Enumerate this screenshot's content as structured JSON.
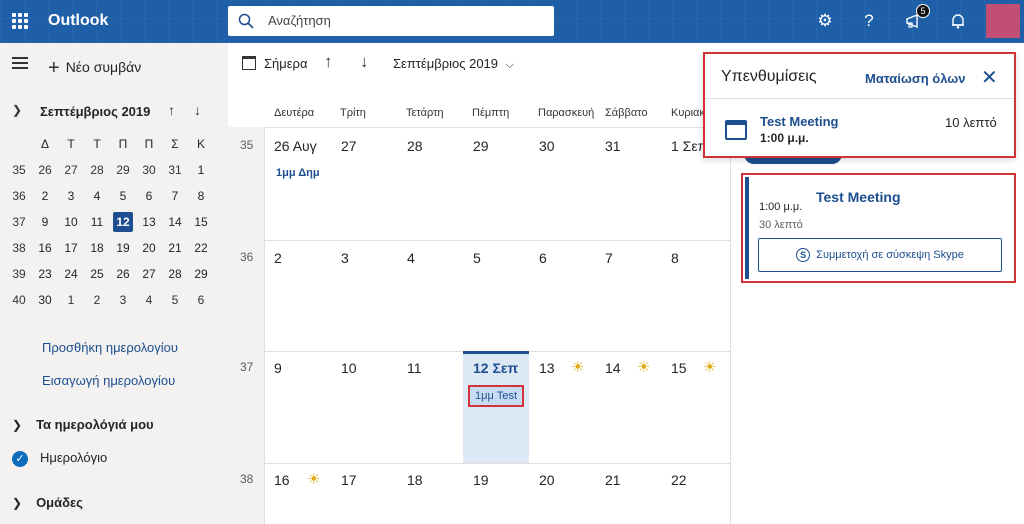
{
  "header": {
    "brand": "Outlook",
    "search_placeholder": "Αναζήτηση",
    "notification_count": "5"
  },
  "sidebar": {
    "new_event": "Νέο συμβάν",
    "mini_title": "Σεπτέμβριος 2019",
    "weekdays": [
      "Δ",
      "Τ",
      "Τ",
      "Π",
      "Π",
      "Σ",
      "Κ"
    ],
    "weeks": [
      {
        "wk": "35",
        "days": [
          "26",
          "27",
          "28",
          "29",
          "30",
          "31",
          "1"
        ]
      },
      {
        "wk": "36",
        "days": [
          "2",
          "3",
          "4",
          "5",
          "6",
          "7",
          "8"
        ]
      },
      {
        "wk": "37",
        "days": [
          "9",
          "10",
          "11",
          "12",
          "13",
          "14",
          "15"
        ]
      },
      {
        "wk": "38",
        "days": [
          "16",
          "17",
          "18",
          "19",
          "20",
          "21",
          "22"
        ]
      },
      {
        "wk": "39",
        "days": [
          "23",
          "24",
          "25",
          "26",
          "27",
          "28",
          "29"
        ]
      },
      {
        "wk": "40",
        "days": [
          "30",
          "1",
          "2",
          "3",
          "4",
          "5",
          "6"
        ]
      }
    ],
    "add_calendar": "Προσθήκη ημερολογίου",
    "import_calendar": "Εισαγωγή ημερολογίου",
    "my_calendars": "Τα ημερολόγιά μου",
    "calendar_item": "Ημερολόγιο",
    "groups": "Ομάδες"
  },
  "toolbar": {
    "today": "Σήμερα",
    "month": "Σεπτέμβριος 2019"
  },
  "calendar": {
    "day_headers": [
      "Δευτέρα",
      "Τρίτη",
      "Τετάρτη",
      "Πέμπτη",
      "Παρασκευή",
      "Σάββατο",
      "Κυριακή"
    ],
    "weeks": [
      {
        "wk": "35",
        "days": [
          "26 Αυγ",
          "27",
          "28",
          "29",
          "30",
          "31",
          "1 Σεπ"
        ]
      },
      {
        "wk": "36",
        "days": [
          "2",
          "3",
          "4",
          "5",
          "6",
          "7",
          "8"
        ]
      },
      {
        "wk": "37",
        "days": [
          "9",
          "10",
          "11",
          "12 Σεπ",
          "13",
          "14",
          "15"
        ]
      },
      {
        "wk": "38",
        "days": [
          "16",
          "17",
          "18",
          "19",
          "20",
          "21",
          "22"
        ]
      }
    ],
    "event_aug26": "1μμ Δημ",
    "event_today": "1μμ Test"
  },
  "reminders": {
    "title": "Υπενθυμίσεις",
    "dismiss_all": "Ματαίωση όλων",
    "event_title": "Test Meeting",
    "event_time": "1:00 μ.μ.",
    "time_left": "10 λεπτό"
  },
  "event_card": {
    "time": "1:00 μ.μ.",
    "title": "Test Meeting",
    "duration": "30 λεπτό",
    "join_button": "Συμμετοχή σε σύσκεψη Skype"
  }
}
